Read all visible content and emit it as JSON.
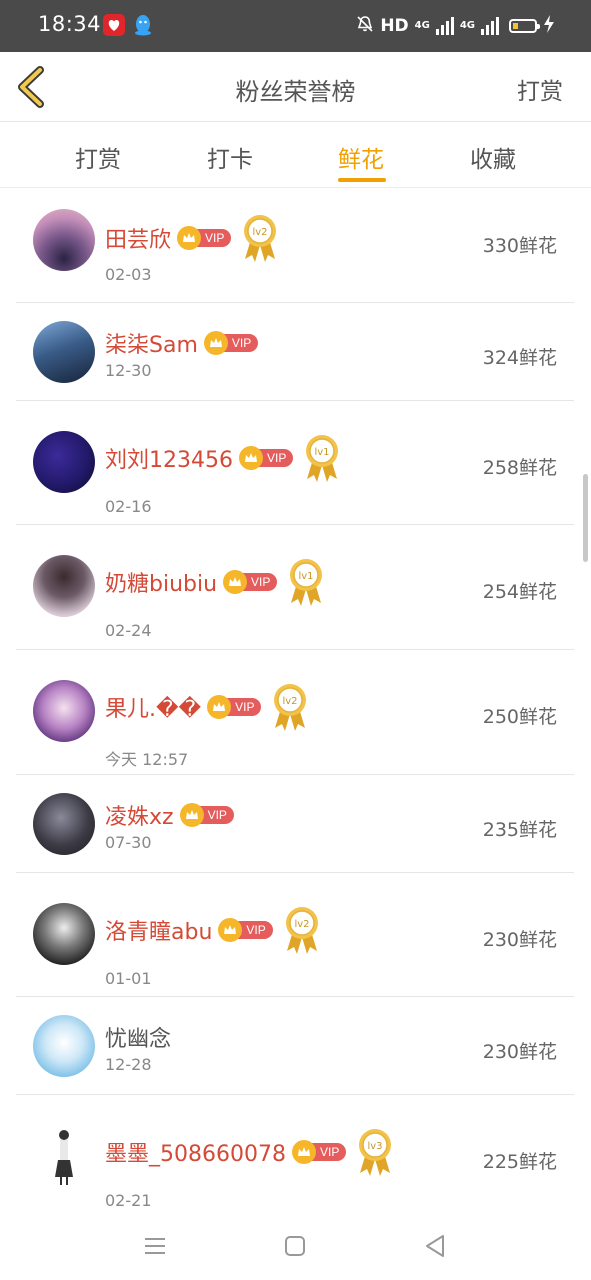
{
  "status_bar": {
    "time": "18:34",
    "hd_label": "HD",
    "net1": "4G",
    "net2": "4G",
    "icons": [
      "app-red-heart-icon",
      "qq-penguin-icon",
      "mute-bell-icon",
      "signal-icon",
      "battery-icon",
      "charging-icon"
    ]
  },
  "header": {
    "title": "粉丝荣誉榜",
    "right_label": "打赏",
    "back_icon": "chevron-left-icon",
    "accent": "#f0a000"
  },
  "tabs": [
    {
      "label": "打赏",
      "active": false
    },
    {
      "label": "打卡",
      "active": false
    },
    {
      "label": "鲜花",
      "active": true
    },
    {
      "label": "收藏",
      "active": false
    }
  ],
  "vip_label": "VIP",
  "fans": [
    {
      "name": "田芸欣",
      "date": "02-03",
      "count": "330鲜花",
      "vip": true,
      "level": "lv2"
    },
    {
      "name": "柒柒Sam",
      "date": "12-30",
      "count": "324鲜花",
      "vip": true,
      "level": ""
    },
    {
      "name": "刘刘123456",
      "date": "02-16",
      "count": "258鲜花",
      "vip": true,
      "level": "lv1"
    },
    {
      "name": "奶糖biubiu",
      "date": "02-24",
      "count": "254鲜花",
      "vip": true,
      "level": "lv1"
    },
    {
      "name": "果儿.��",
      "date": "今天 12:57",
      "count": "250鲜花",
      "vip": true,
      "level": "lv2"
    },
    {
      "name": "凌姝xz",
      "date": "07-30",
      "count": "235鲜花",
      "vip": true,
      "level": ""
    },
    {
      "name": "洛青瞳abu",
      "date": "01-01",
      "count": "230鲜花",
      "vip": true,
      "level": "lv2"
    },
    {
      "name": "忧幽念",
      "date": "12-28",
      "count": "230鲜花",
      "vip": false,
      "level": ""
    },
    {
      "name": "墨墨_508660078",
      "date": "02-21",
      "count": "225鲜花",
      "vip": true,
      "level": "lv3"
    }
  ],
  "colors": {
    "vip_name": "#d44a36",
    "vip_tag": "#e45c5c",
    "crown": "#f5b62a",
    "medal": "#e0a526"
  },
  "bottom_nav": [
    "menu-icon",
    "home-square-icon",
    "back-triangle-icon"
  ]
}
